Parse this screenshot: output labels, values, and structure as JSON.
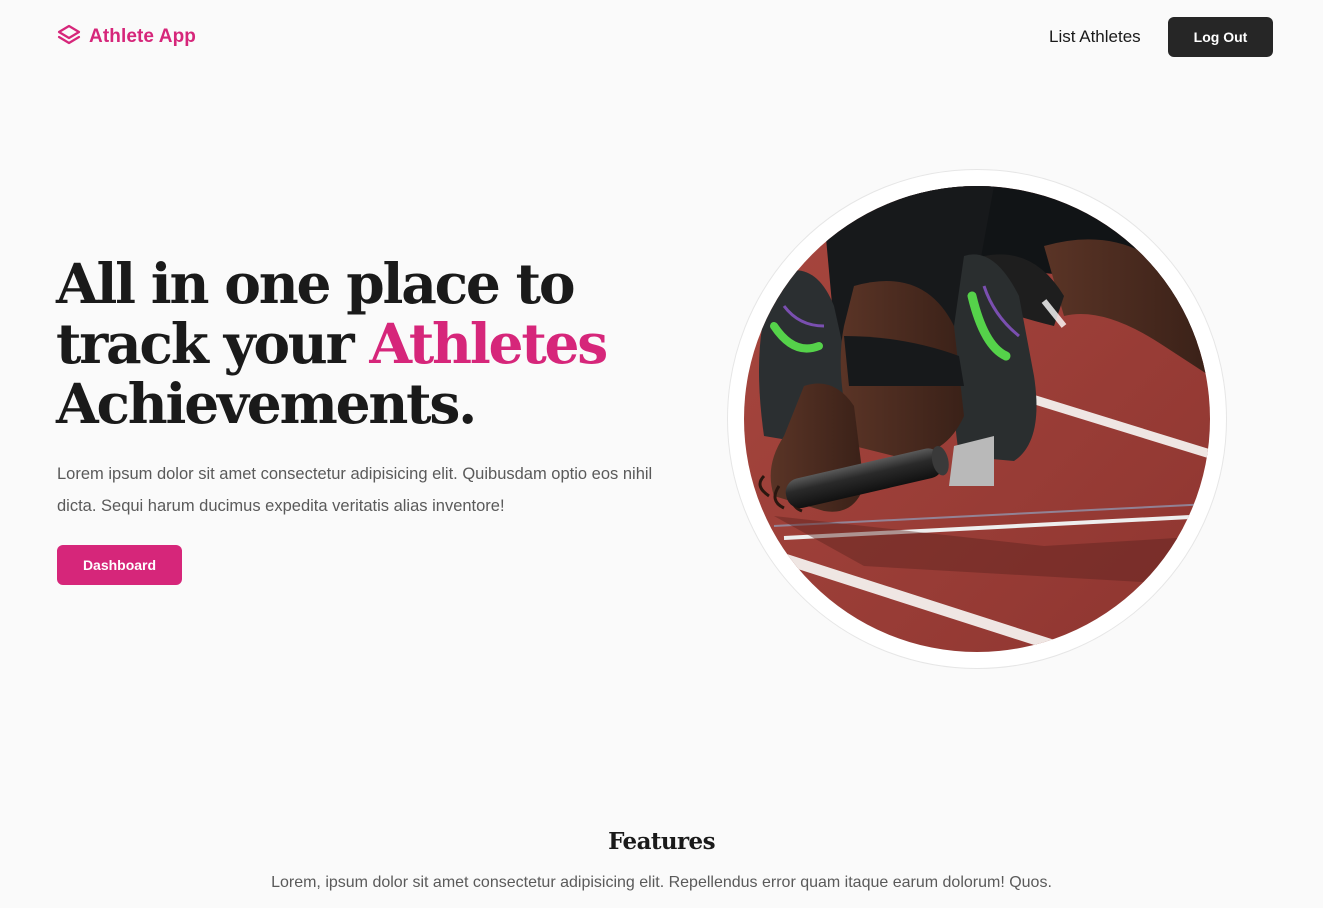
{
  "header": {
    "brand_name": "Athlete App",
    "nav_link": "List Athletes",
    "logout_label": "Log Out"
  },
  "hero": {
    "title_part1": "All in one place to track your ",
    "title_accent": "Athletes",
    "title_part2": " Achievements.",
    "description": "Lorem ipsum dolor sit amet consectetur adipisicing elit. Quibusdam optio eos nihil dicta. Sequi harum ducimus expedita veritatis alias inventore!",
    "cta_label": "Dashboard",
    "image_icon": "sprinter-starting-block-photo"
  },
  "features": {
    "title": "Features",
    "description": "Lorem, ipsum dolor sit amet consectetur adipisicing elit. Repellendus error quam itaque earum dolorum! Quos."
  },
  "colors": {
    "accent": "#d6267a",
    "dark": "#262626",
    "background": "#fafafa",
    "text": "#1a1a1a",
    "muted": "#5a5a5a"
  },
  "icons": {
    "brand": "layers-icon"
  }
}
